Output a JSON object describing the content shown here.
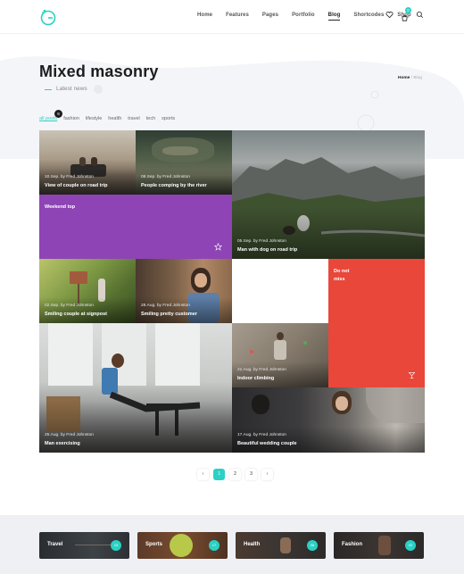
{
  "header": {
    "nav": [
      "Home",
      "Features",
      "Pages",
      "Portfolio",
      "Blog",
      "Shortcodes",
      "Shop"
    ],
    "active_nav": "Blog",
    "cart_count": "0",
    "icons": [
      "heart-icon",
      "cart-icon",
      "search-icon"
    ]
  },
  "page": {
    "title": "Mixed masonry",
    "subtitle": "Latest news",
    "breadcrumb_home": "Home",
    "breadcrumb_sep": "/",
    "breadcrumb_current": "Blog"
  },
  "filters": {
    "items": [
      "all posts",
      "fashion",
      "lifestyle",
      "health",
      "travel",
      "tech",
      "sports"
    ],
    "active": "all posts",
    "count": "8"
  },
  "posts": [
    {
      "meta": "10.Sep. by Fred Johnston",
      "title": "View of couple on road trip"
    },
    {
      "meta": "08.Sep. by Fred Johnston",
      "title": "People comping by the river"
    },
    {
      "meta": "",
      "title": "Weekend top"
    },
    {
      "meta": "05.Sep. by Fred Johnston",
      "title": "Man with dog on road trip"
    },
    {
      "meta": "02.Sep. by Fred Johnston",
      "title": "Smiling couple at signpost"
    },
    {
      "meta": "28.Aug. by Fred Johnston",
      "title": "Smiling pretty customer"
    },
    {
      "meta": "",
      "title": "Do not miss"
    },
    {
      "meta": "25.Aug. by Fred Johnston",
      "title": "Man exercising"
    },
    {
      "meta": "21.Aug. by Fred Johnston",
      "title": "Indoor climbing"
    },
    {
      "meta": "17.Aug. by Fred Johnston",
      "title": "Beautiful wedding couple"
    }
  ],
  "pagination": {
    "prev": "‹",
    "pages": [
      "1",
      "2",
      "3"
    ],
    "next": "›",
    "active": "1"
  },
  "categories": [
    {
      "label": "Travel",
      "count": "15"
    },
    {
      "label": "Sports",
      "count": "17"
    },
    {
      "label": "Health",
      "count": "06"
    },
    {
      "label": "Fashion",
      "count": "02"
    }
  ],
  "colors": {
    "accent": "#2ad1c4",
    "purple": "#8e44b5",
    "red": "#e8473a"
  }
}
